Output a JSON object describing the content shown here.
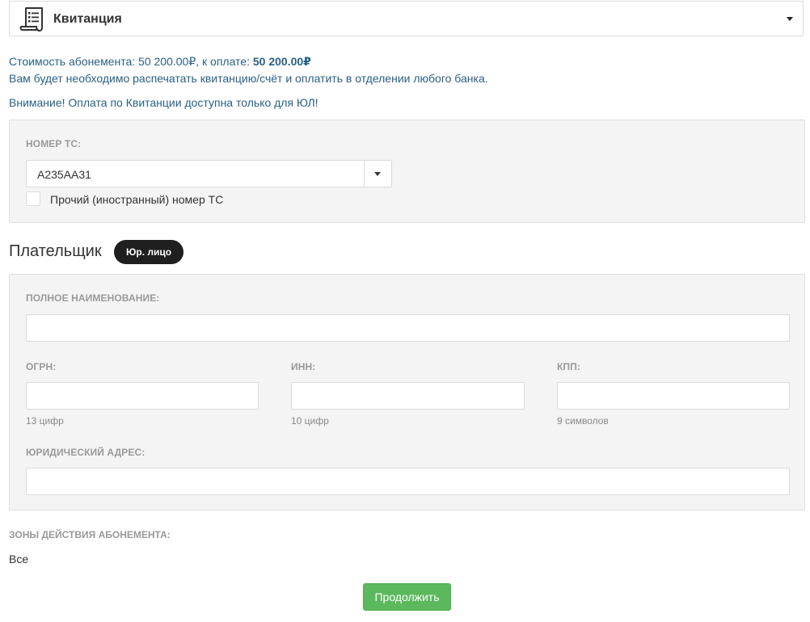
{
  "header": {
    "title": "Квитанция",
    "icon": "receipt-icon"
  },
  "info": {
    "cost_prefix": "Стоимость абонемента: 50 200.00₽, к оплате: ",
    "cost_total": "50 200.00₽",
    "print_note": "Вам будет необходимо распечатать квитанцию/счёт и оплатить в отделении любого банка.",
    "warning": "Внимание! Оплата по Квитанции доступна только для ЮЛ!"
  },
  "vehicle": {
    "label": "НОМЕР ТС:",
    "selected": "А235АА31",
    "foreign_label": "Прочий (иностранный) номер ТС"
  },
  "payer": {
    "title": "Плательщик",
    "type_badge": "Юр. лицо"
  },
  "company": {
    "full_name_label": "ПОЛНОЕ НАИМЕНОВАНИЕ:",
    "ogrn_label": "ОГРН:",
    "ogrn_help": "13 цифр",
    "inn_label": "ИНН:",
    "inn_help": "10 цифр",
    "kpp_label": "КПП:",
    "kpp_help": "9 символов",
    "address_label": "ЮРИДИЧЕСКИЙ АДРЕС:"
  },
  "zones": {
    "label": "ЗОНЫ ДЕЙСТВИЯ АБОНЕМЕНТА:",
    "value": "Все"
  },
  "actions": {
    "continue_label": "Продолжить"
  },
  "colors": {
    "info_text": "#2a6085",
    "button": "#5cb85c",
    "badge": "#1f1f1f"
  }
}
